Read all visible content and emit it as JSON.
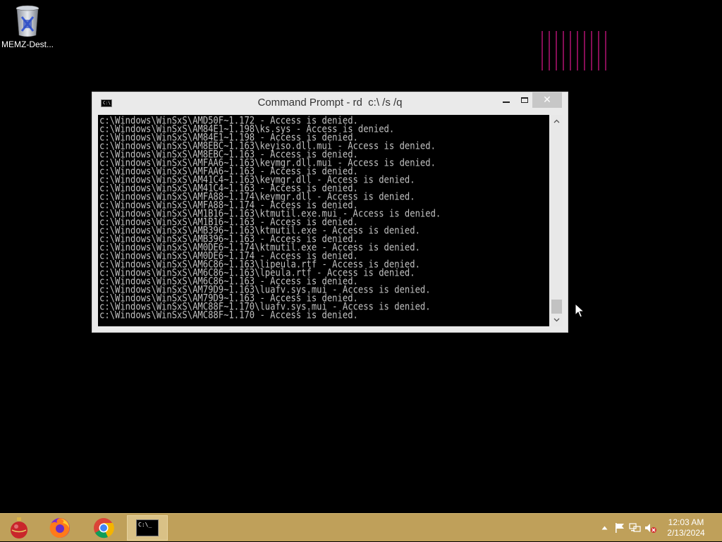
{
  "desktop": {
    "icons": [
      {
        "label": "MEMZ-Dest..."
      }
    ]
  },
  "window": {
    "title": "Command Prompt - rd  c:\\ /s /q",
    "icon_text": "C:\\",
    "controls": {
      "minimize": "minimize",
      "maximize": "maximize",
      "close": "✕"
    },
    "console_lines": [
      "c:\\Windows\\WinSxS\\AMD50F~1.172 - Access is denied.",
      "c:\\Windows\\WinSxS\\AM84E1~1.198\\ks.sys - Access is denied.",
      "c:\\Windows\\WinSxS\\AM84E1~1.198 - Access is denied.",
      "c:\\Windows\\WinSxS\\AM8EBC~1.163\\keyiso.dll.mui - Access is denied.",
      "c:\\Windows\\WinSxS\\AM8EBC~1.163 - Access is denied.",
      "c:\\Windows\\WinSxS\\AMFAA6~1.163\\keymgr.dll.mui - Access is denied.",
      "c:\\Windows\\WinSxS\\AMFAA6~1.163 - Access is denied.",
      "c:\\Windows\\WinSxS\\AM41C4~1.163\\keymgr.dll - Access is denied.",
      "c:\\Windows\\WinSxS\\AM41C4~1.163 - Access is denied.",
      "c:\\Windows\\WinSxS\\AMFA88~1.174\\keymgr.dll - Access is denied.",
      "c:\\Windows\\WinSxS\\AMFA88~1.174 - Access is denied.",
      "c:\\Windows\\WinSxS\\AM1B16~1.163\\ktmutil.exe.mui - Access is denied.",
      "c:\\Windows\\WinSxS\\AM1B16~1.163 - Access is denied.",
      "c:\\Windows\\WinSxS\\AMB396~1.163\\ktmutil.exe - Access is denied.",
      "c:\\Windows\\WinSxS\\AMB396~1.163 - Access is denied.",
      "c:\\Windows\\WinSxS\\AM0DE6~1.174\\ktmutil.exe - Access is denied.",
      "c:\\Windows\\WinSxS\\AM0DE6~1.174 - Access is denied.",
      "c:\\Windows\\WinSxS\\AM6C86~1.163\\lipeula.rtf - Access is denied.",
      "c:\\Windows\\WinSxS\\AM6C86~1.163\\lpeula.rtf - Access is denied.",
      "c:\\Windows\\WinSxS\\AM6C86~1.163 - Access is denied.",
      "c:\\Windows\\WinSxS\\AM79D9~1.163\\luafv.sys.mui - Access is denied.",
      "c:\\Windows\\WinSxS\\AM79D9~1.163 - Access is denied.",
      "c:\\Windows\\WinSxS\\AMC88F~1.170\\luafv.sys.mui - Access is denied.",
      "c:\\Windows\\WinSxS\\AMC88F~1.170 - Access is denied."
    ]
  },
  "taskbar": {
    "apps": [
      {
        "name": "ornament-app"
      },
      {
        "name": "firefox"
      },
      {
        "name": "chrome"
      },
      {
        "name": "command-prompt",
        "icon_text": "C:\\_",
        "active": true
      }
    ],
    "tray": {
      "icons": [
        "chevron-up-icon",
        "flag-icon",
        "network-icon",
        "volume-muted-icon"
      ]
    },
    "clock": {
      "time": "12:03 AM",
      "date": "2/13/2024"
    }
  },
  "colors": {
    "desktop_bg": "#000000",
    "taskbar_bg": "#bfa05a",
    "console_text": "#c0c0c0",
    "stripes": "#c0147a"
  }
}
